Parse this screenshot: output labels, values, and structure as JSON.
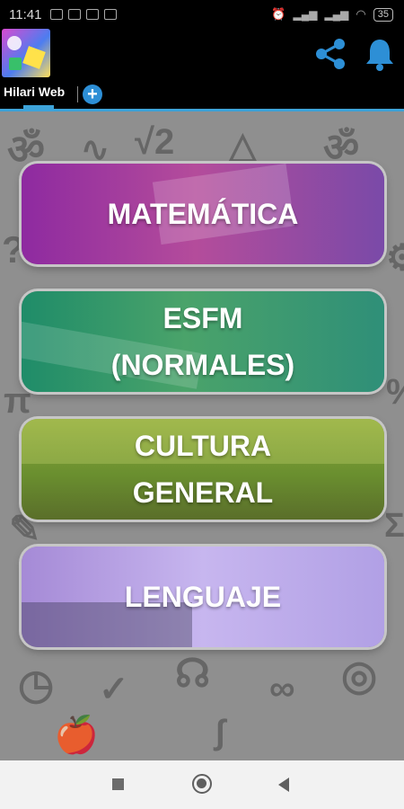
{
  "status_bar": {
    "time": "11:41",
    "battery": "35"
  },
  "tab": {
    "label": "Hilari Web",
    "add_symbol": "+"
  },
  "cards": [
    {
      "label": "MATEMÁTICA"
    },
    {
      "label": "ESFM\n(NORMALES)"
    },
    {
      "label": "CULTURA\nGENERAL"
    },
    {
      "label": "LENGUAJE"
    }
  ],
  "colors": {
    "accent": "#3da3d9",
    "icon_blue": "#2d8fd6",
    "background": "#8f8f8f"
  },
  "icons": [
    "share-icon",
    "bell-icon",
    "add-icon",
    "recents-icon",
    "home-icon",
    "back-icon"
  ]
}
